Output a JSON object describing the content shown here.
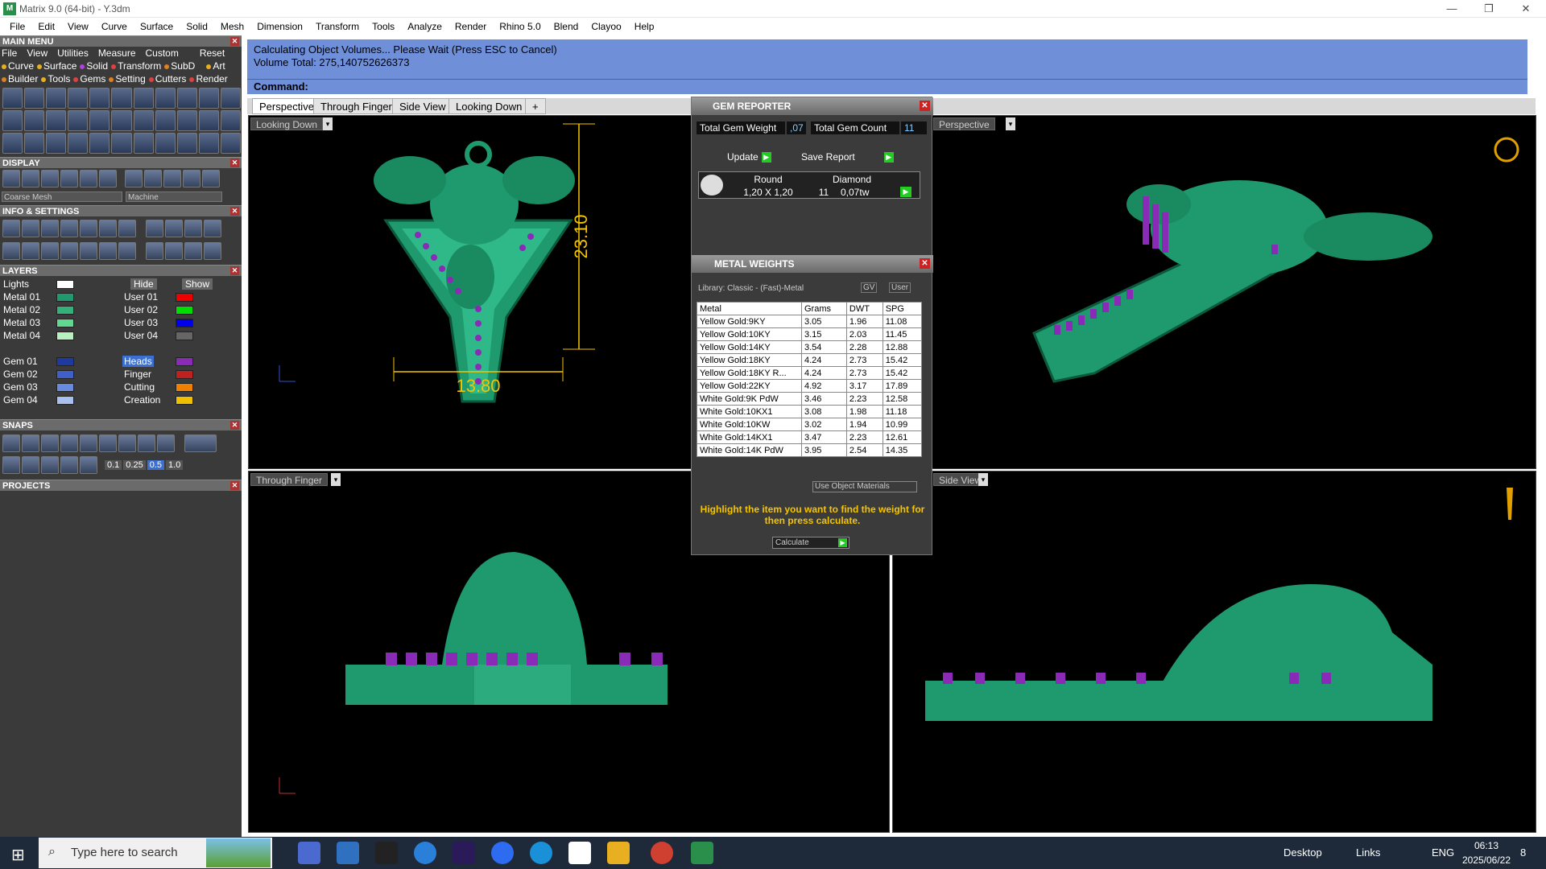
{
  "window": {
    "title": "Matrix 9.0 (64-bit) - Y.3dm",
    "minimize": "—",
    "restore": "❐",
    "close": "✕"
  },
  "menubar": [
    "File",
    "Edit",
    "View",
    "Curve",
    "Surface",
    "Solid",
    "Mesh",
    "Dimension",
    "Transform",
    "Tools",
    "Analyze",
    "Render",
    "Rhino 5.0",
    "Blend",
    "Clayoo",
    "Help"
  ],
  "left": {
    "main_menu": "MAIN MENU",
    "menu_row": [
      "File",
      "View",
      "Utilities",
      "Measure",
      "Custom",
      "Reset"
    ],
    "cat_row1": [
      "Curve",
      "Surface",
      "Solid",
      "Transform",
      "SubD",
      "Art"
    ],
    "cat_row2": [
      "Builder",
      "Tools",
      "Gems",
      "Setting",
      "Cutters",
      "Render"
    ],
    "display": "DISPLAY",
    "display_combo1": "Coarse Mesh",
    "display_combo2": "Machine",
    "info": "INFO & SETTINGS",
    "layers": "LAYERS",
    "lights": "Lights",
    "hide": "Hide",
    "show": "Show",
    "metal_layers": [
      "Metal 01",
      "Metal 02",
      "Metal 03",
      "Metal 04"
    ],
    "gem_layers": [
      "Gem 01",
      "Gem 02",
      "Gem 03",
      "Gem 04"
    ],
    "user_layers": [
      "User 01",
      "User 02",
      "User 03",
      "User 04"
    ],
    "other_layers": [
      "Heads",
      "Finger",
      "Cutting",
      "Creation"
    ],
    "snaps": "SNAPS",
    "snap_values": [
      "0.1",
      "0.25",
      "0.5",
      "1.0"
    ],
    "projects": "PROJECTS"
  },
  "command": {
    "line1": "Calculating Object Volumes... Please Wait (Press ESC to Cancel)",
    "line2": "Volume Total: 275,140752626373",
    "label": "Command:"
  },
  "tabs": [
    "Perspective",
    "Through Finger",
    "Side View",
    "Looking Down"
  ],
  "viewports": {
    "tl": "Looking Down",
    "tr": "Perspective",
    "bl": "Through Finger",
    "br": "Side View",
    "dim_h": "23.10",
    "dim_w": "13.80"
  },
  "gem_reporter": {
    "title": "GEM REPORTER",
    "total_weight_label": "Total Gem Weight",
    "total_weight": ",07",
    "total_count_label": "Total Gem Count",
    "total_count": "11",
    "update": "Update",
    "save_report": "Save Report",
    "gem": {
      "cut": "Round",
      "material": "Diamond",
      "size": "1,20 X 1,20",
      "count": "11",
      "weight": "0,07tw"
    }
  },
  "metal_weights": {
    "title": "METAL WEIGHTS",
    "library": "Library: Classic - (Fast)-Metal",
    "gv": "GV",
    "user": "User",
    "headers": [
      "Metal",
      "Grams",
      "DWT",
      "SPG"
    ],
    "rows": [
      [
        "Yellow Gold:9KY",
        "3.05",
        "1.96",
        "11.08"
      ],
      [
        "Yellow Gold:10KY",
        "3.15",
        "2.03",
        "11.45"
      ],
      [
        "Yellow Gold:14KY",
        "3.54",
        "2.28",
        "12.88"
      ],
      [
        "Yellow Gold:18KY",
        "4.24",
        "2.73",
        "15.42"
      ],
      [
        "Yellow Gold:18KY R...",
        "4.24",
        "2.73",
        "15.42"
      ],
      [
        "Yellow Gold:22KY",
        "4.92",
        "3.17",
        "17.89"
      ],
      [
        "White Gold:9K PdW",
        "3.46",
        "2.23",
        "12.58"
      ],
      [
        "White Gold:10KX1",
        "3.08",
        "1.98",
        "11.18"
      ],
      [
        "White Gold:10KW",
        "3.02",
        "1.94",
        "10.99"
      ],
      [
        "White Gold:14KX1",
        "3.47",
        "2.23",
        "12.61"
      ],
      [
        "White Gold:14K PdW",
        "3.95",
        "2.54",
        "14.35"
      ]
    ],
    "use_object_materials": "Use Object Materials",
    "note": "Highlight the item you want to find the weight for then press calculate.",
    "calculate": "Calculate"
  },
  "taskbar": {
    "search_placeholder": "Type here to search",
    "desktop": "Desktop",
    "links": "Links",
    "lang": "ENG",
    "time": "06:13",
    "date": "2025/06/22",
    "notif": "8"
  },
  "colors": {
    "metal_green": "#1f9a6e",
    "gem_purple": "#8a2bb8",
    "cmd_blue": "#6f8fd9",
    "dim_yellow": "#f5c400"
  }
}
